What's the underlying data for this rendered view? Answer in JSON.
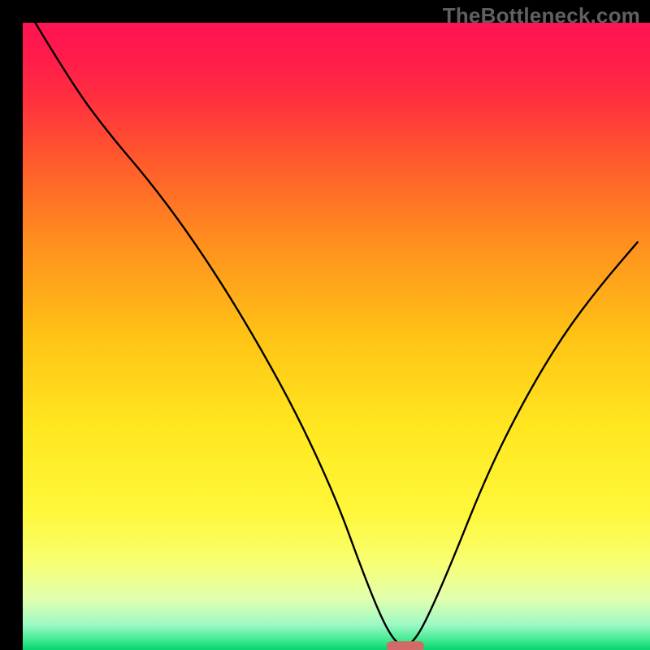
{
  "watermark": "TheBottleneck.com",
  "chart_data": {
    "type": "line",
    "title": "",
    "xlabel": "",
    "ylabel": "",
    "xlim": [
      0,
      100
    ],
    "ylim": [
      0,
      100
    ],
    "grid": false,
    "legend": false,
    "background_gradient": [
      {
        "stop": 0.0,
        "color": "#ff1453"
      },
      {
        "stop": 0.05,
        "color": "#ff1a4c"
      },
      {
        "stop": 0.12,
        "color": "#ff2f3f"
      },
      {
        "stop": 0.22,
        "color": "#ff5a2c"
      },
      {
        "stop": 0.35,
        "color": "#ff8f1e"
      },
      {
        "stop": 0.5,
        "color": "#ffc316"
      },
      {
        "stop": 0.65,
        "color": "#ffe820"
      },
      {
        "stop": 0.78,
        "color": "#fff73a"
      },
      {
        "stop": 0.86,
        "color": "#f8ff72"
      },
      {
        "stop": 0.92,
        "color": "#e0ffb0"
      },
      {
        "stop": 0.96,
        "color": "#9cf9c5"
      },
      {
        "stop": 0.985,
        "color": "#3de98e"
      },
      {
        "stop": 1.0,
        "color": "#08d46e"
      }
    ],
    "series": [
      {
        "name": "curve",
        "x": [
          2,
          8,
          14,
          20,
          26,
          32,
          38,
          44,
          50,
          54,
          57,
          59,
          60.5,
          62,
          64,
          68,
          74,
          80,
          86,
          92,
          98
        ],
        "y": [
          100,
          90,
          82,
          75,
          67,
          58,
          48,
          37,
          24,
          13,
          5.5,
          1.8,
          0.6,
          1.0,
          4.0,
          13,
          28,
          40,
          50,
          58,
          65
        ]
      }
    ],
    "marker": {
      "x": 61,
      "y": 0.6,
      "width_pct": 6,
      "height_pct": 1.6,
      "color": "#d06b68"
    }
  }
}
